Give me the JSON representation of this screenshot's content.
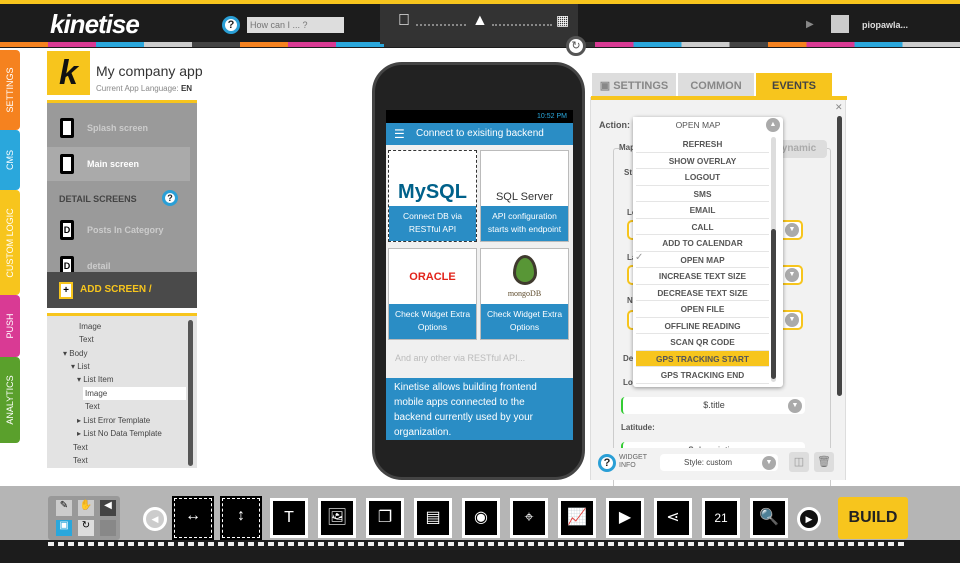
{
  "header": {
    "logo": "kinetise",
    "search_placeholder": "How can I ... ?",
    "help": "?",
    "platforms": [
      "apple-icon",
      "android-icon",
      "windows-icon"
    ],
    "username": "piopawla..."
  },
  "side_tabs": [
    {
      "label": "SETTINGS",
      "color": "#f5821f"
    },
    {
      "label": "CMS",
      "color": "#2aa7dc"
    },
    {
      "label": "CUSTOM LOGIC",
      "color": "#f7c51d"
    },
    {
      "label": "PUSH",
      "color": "#d93a94"
    },
    {
      "label": "ANALYTICS",
      "color": "#5aa02c"
    }
  ],
  "app": {
    "name": "My company app",
    "lang_label": "Current App Language:",
    "lang": "EN"
  },
  "screens": {
    "items": [
      {
        "label": "Splash screen",
        "icon": ""
      },
      {
        "label": "Main screen",
        "icon": ""
      }
    ],
    "detail_header": "DETAIL SCREENS",
    "details": [
      {
        "label": "Posts In Category",
        "icon": "D"
      },
      {
        "label": "detail",
        "icon": "D"
      }
    ],
    "add_label": "ADD SCREEN / OVERLAY",
    "add_icon": "+"
  },
  "tree": [
    "Image",
    "Text",
    "Body",
    "List",
    "List Item",
    "Image",
    "Text",
    "List Error Template",
    "List No Data Template",
    "Text",
    "Text"
  ],
  "phone": {
    "time": "10:52 PM",
    "title": "Connect to exisiting backend",
    "cards": [
      {
        "logo": "MySQL",
        "caption": "Connect DB via RESTful API"
      },
      {
        "logo": "SQL Server",
        "caption": "API configuration starts with endpoint"
      },
      {
        "logo": "ORACLE",
        "caption": "Check Widget Extra Options"
      },
      {
        "logo": "mongoDB",
        "caption": "Check Widget Extra Options"
      }
    ],
    "hint": "And any other via RESTful API...",
    "text": "Kinetise allows building frontend mobile apps connected to the backend currently used by your organization."
  },
  "panel": {
    "tabs": [
      "SETTINGS",
      "COMMON",
      "EVENTS"
    ],
    "active_tab": "EVENTS",
    "action_label": "Action:",
    "action_value": "OPEN MAP",
    "options": [
      "REFRESH",
      "SHOW OVERLAY",
      "LOGOUT",
      "SMS",
      "EMAIL",
      "CALL",
      "ADD TO CALENDAR",
      "OPEN MAP",
      "INCREASE TEXT SIZE",
      "DECREASE TEXT SIZE",
      "OPEN FILE",
      "OFFLINE READING",
      "SCAN QR CODE",
      "GPS TRACKING START",
      "GPS TRACKING END"
    ],
    "checked": "OPEN MAP",
    "highlighted": "GPS TRACKING START",
    "dynamic": "ynamic",
    "partial_labels": [
      "Map",
      "St",
      "Lo",
      "La",
      "Na",
      "De",
      "Lo"
    ],
    "longitude_value": "$.title",
    "latitude_label": "Latitude:",
    "latitude_value": "$.description",
    "widget_info": "WIDGET INFO",
    "style": "Style: custom"
  },
  "toolbar": {
    "tools": [
      "horizontal-icon",
      "vertical-icon",
      "text-icon",
      "image-icon",
      "pages-icon",
      "gallery-icon",
      "video-list-icon",
      "map-icon",
      "chart-icon",
      "video-icon",
      "share-icon",
      "calendar-icon",
      "web-search-icon"
    ],
    "calendar_day": "21",
    "build": "BUILD"
  }
}
